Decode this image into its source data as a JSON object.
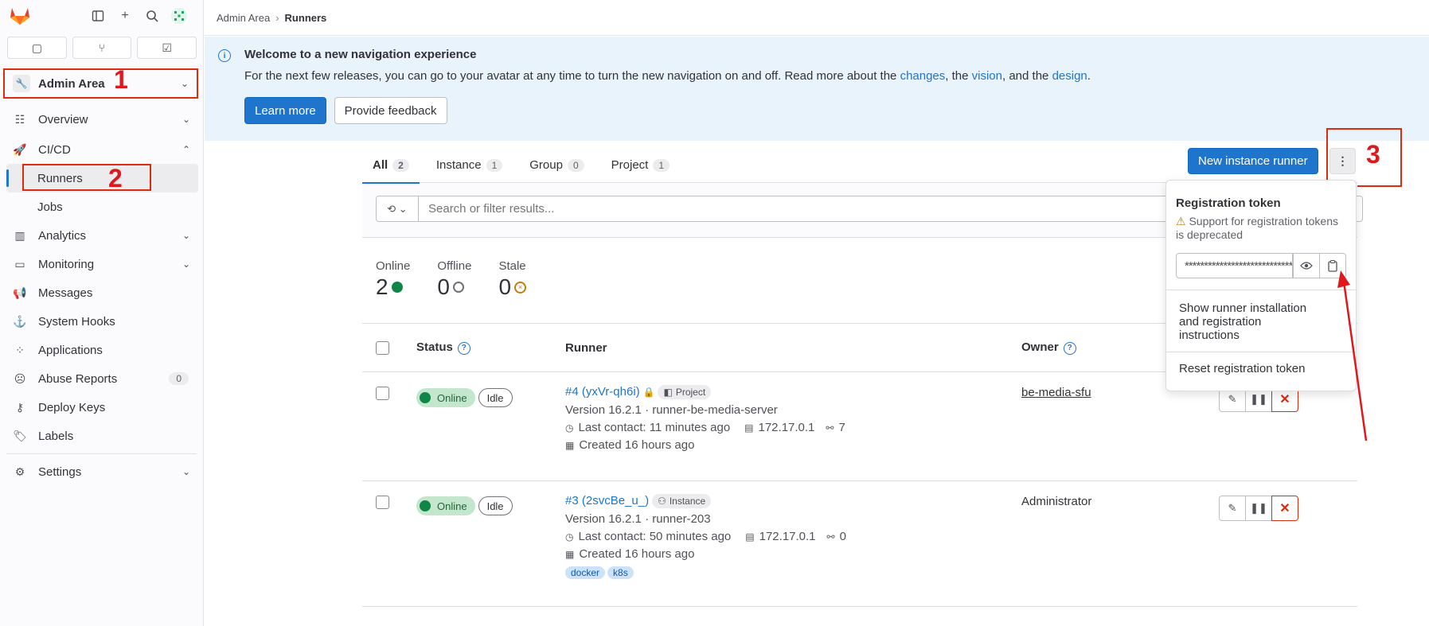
{
  "sidebar": {
    "counters": [
      "issues",
      "merge-requests",
      "todos"
    ],
    "context_label": "Admin Area",
    "items": [
      {
        "label": "Overview",
        "icon": "overview-icon"
      },
      {
        "label": "CI/CD",
        "icon": "rocket-icon"
      },
      {
        "label": "Runners",
        "icon": ""
      },
      {
        "label": "Jobs",
        "icon": ""
      },
      {
        "label": "Analytics",
        "icon": "chart-icon"
      },
      {
        "label": "Monitoring",
        "icon": "monitor-icon"
      },
      {
        "label": "Messages",
        "icon": "bullhorn-icon"
      },
      {
        "label": "System Hooks",
        "icon": "anchor-icon"
      },
      {
        "label": "Applications",
        "icon": "applications-icon"
      },
      {
        "label": "Abuse Reports",
        "icon": "abuse-icon",
        "badge": "0"
      },
      {
        "label": "Deploy Keys",
        "icon": "key-icon"
      },
      {
        "label": "Labels",
        "icon": "label-icon"
      },
      {
        "label": "Settings",
        "icon": "settings-icon"
      }
    ]
  },
  "breadcrumb": {
    "parent": "Admin Area",
    "current": "Runners"
  },
  "banner": {
    "title": "Welcome to a new navigation experience",
    "text_before": "For the next few releases, you can go to your avatar at any time to turn the new navigation on and off. Read more about the ",
    "link_changes": "changes",
    "text_mid1": ", the ",
    "link_vision": "vision",
    "text_mid2": ", and the ",
    "link_design": "design",
    "text_end": ".",
    "learn_more": "Learn more",
    "feedback": "Provide feedback"
  },
  "tabs": [
    {
      "label": "All",
      "count": "2"
    },
    {
      "label": "Instance",
      "count": "1"
    },
    {
      "label": "Group",
      "count": "0"
    },
    {
      "label": "Project",
      "count": "1"
    }
  ],
  "new_runner_label": "New instance runner",
  "search": {
    "placeholder": "Search or filter results..."
  },
  "stats": [
    {
      "label": "Online",
      "value": "2"
    },
    {
      "label": "Offline",
      "value": "0"
    },
    {
      "label": "Stale",
      "value": "0"
    }
  ],
  "table": {
    "headers": {
      "status": "Status",
      "runner": "Runner",
      "owner": "Owner"
    },
    "rows": [
      {
        "status": "Online",
        "state": "Idle",
        "name": "#4 (yxVr-qh6i)",
        "type": "Project",
        "version": "Version 16.2.1 · runner-be-media-server",
        "last_contact": "Last contact: 11 minutes ago",
        "ip": "172.17.0.1",
        "jobs": "7",
        "created": "Created 16 hours ago",
        "owner": "be-media-sfu",
        "tags": []
      },
      {
        "status": "Online",
        "state": "Idle",
        "name": "#3 (2svcBe_u_)",
        "type": "Instance",
        "version": "Version 16.2.1 · runner-203",
        "last_contact": "Last contact: 50 minutes ago",
        "ip": "172.17.0.1",
        "jobs": "0",
        "created": "Created 16 hours ago",
        "owner": "Administrator",
        "tags": [
          "docker",
          "k8s"
        ]
      }
    ]
  },
  "dropdown": {
    "title": "Registration token",
    "warning": "Support for registration tokens is deprecated",
    "token_value": "****************************",
    "show_instructions": "Show runner installation and registration instructions",
    "reset": "Reset registration token"
  },
  "annotations": [
    "1",
    "2",
    "3"
  ],
  "colors": {
    "accent": "#1f75cb",
    "annotation": "#e0171b",
    "online": "#108548"
  }
}
